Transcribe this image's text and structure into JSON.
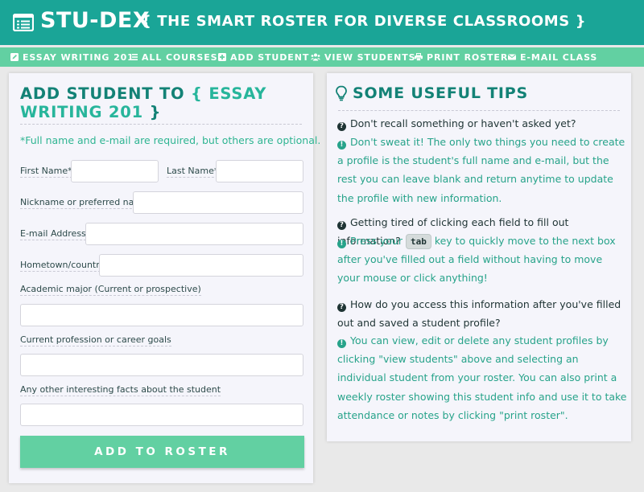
{
  "header": {
    "brand": "STU-DEX",
    "tagline": "{ THE SMART ROSTER FOR DIVERSE CLASSROOMS }",
    "icon": "list-card-icon"
  },
  "nav": {
    "items": [
      {
        "label": "ESSAY WRITING 201",
        "icon": "edit-icon"
      },
      {
        "label": "ALL COURSES",
        "icon": "list-icon"
      },
      {
        "label": "ADD STUDENT",
        "icon": "plus-square-icon"
      },
      {
        "label": "VIEW STUDENTS",
        "icon": "users-icon"
      },
      {
        "label": "PRINT ROSTER",
        "icon": "print-icon"
      },
      {
        "label": "E-MAIL CLASS",
        "icon": "envelope-icon"
      }
    ]
  },
  "form": {
    "title_prefix": "ADD STUDENT TO",
    "open_brace": "{",
    "course_line1": "ESSAY",
    "course_line2": "WRITING 201",
    "close_brace": "}",
    "note": "*Full name and e-mail are required, but others are optional.",
    "labels": {
      "first_name": "First Name*",
      "last_name": "Last Name*",
      "nickname": "Nickname or preferred name",
      "email": "E-mail Address*",
      "hometown": "Hometown/country",
      "major": "Academic major (Current or prospective)",
      "profession": "Current profession or career goals",
      "facts": "Any other interesting facts about the student"
    },
    "values": {
      "first_name": "",
      "last_name": "",
      "nickname": "",
      "email": "",
      "hometown": "",
      "major": "",
      "profession": "",
      "facts": ""
    },
    "submit_label": "ADD TO ROSTER"
  },
  "tips": {
    "title": "SOME USEFUL TIPS",
    "icon": "lightbulb-icon",
    "q1": "Don't recall something or haven't asked yet?",
    "a1": "Don't sweat it! The only two things you need to create a profile is the student's full name and e-mail, but the rest you can leave blank and return anytime to update the profile with new information.",
    "q2": "Getting tired of clicking each field to fill out information?",
    "a2_before": "Press your",
    "a2_key": "tab",
    "a2_after": "key to quickly move to the next box after you've filled out a field without having to move your mouse or click anything!",
    "q3": "How do you access this information after you've filled out and saved a student profile?",
    "a3": "You can view, edit or delete any student profiles by clicking \"view students\" above and selecting an individual student from your roster. You can also print a weekly roster showing this student info and use it to take attendance or notes by clicking \"print roster\"."
  },
  "colors": {
    "header_bg": "#1aa597",
    "nav_bg": "#62d0a2",
    "title": "#138276",
    "accent": "#27b59b",
    "answer": "#27a38a"
  }
}
